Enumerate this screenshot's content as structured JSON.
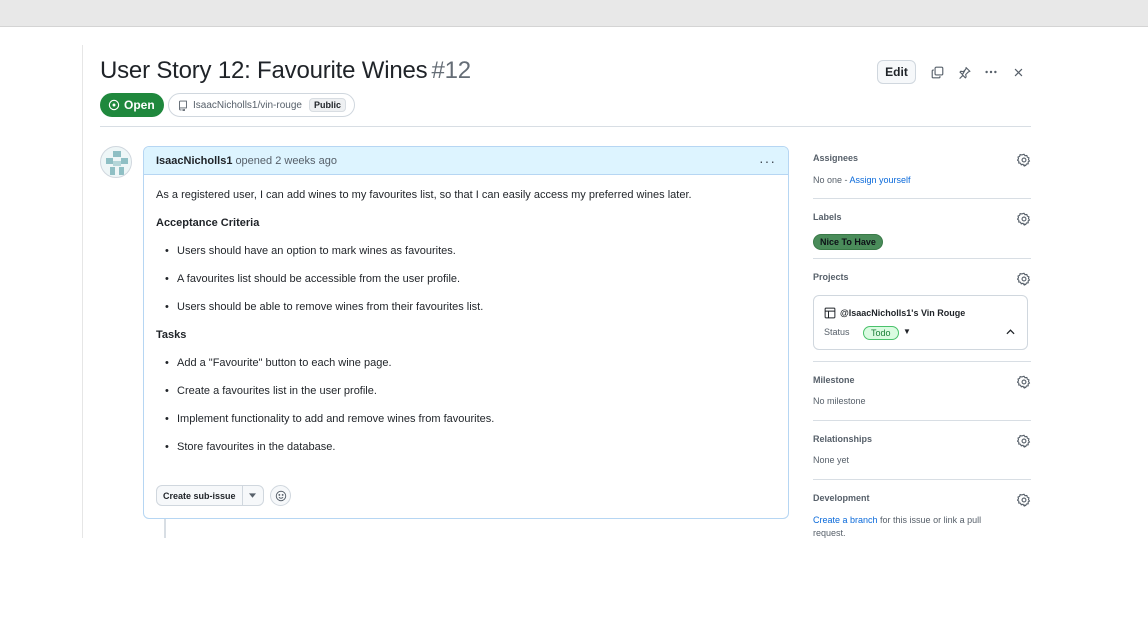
{
  "issue": {
    "title": "User Story 12: Favourite Wines",
    "number": "#12",
    "state": "Open",
    "repo": "IsaacNicholls1/vin-rouge",
    "visibility": "Public",
    "edit_label": "Edit"
  },
  "comment": {
    "author": "IsaacNicholls1",
    "meta": "opened 2 weeks ago",
    "intro": "As a registered user, I can add wines to my favourites list, so that I can easily access my preferred wines later.",
    "sections": [
      {
        "heading": "Acceptance Criteria",
        "items": [
          "Users should have an option to mark wines as favourites.",
          "A favourites list should be accessible from the user profile.",
          "Users should be able to remove wines from their favourites list."
        ]
      },
      {
        "heading": "Tasks",
        "items": [
          "Add a \"Favourite\" button to each wine page.",
          "Create a favourites list in the user profile.",
          "Implement functionality to add and remove wines from favourites.",
          "Store favourites in the database."
        ]
      }
    ],
    "sub_issue_label": "Create sub-issue"
  },
  "sidebar": {
    "assignees": {
      "title": "Assignees",
      "none": "No one - ",
      "link": "Assign yourself"
    },
    "labels": {
      "title": "Labels",
      "items": [
        "Nice To Have"
      ],
      "color": "#4a8c5a"
    },
    "projects": {
      "title": "Projects",
      "project_name": "@IsaacNicholls1's Vin Rouge",
      "status_label": "Status",
      "status_value": "Todo"
    },
    "milestone": {
      "title": "Milestone",
      "value": "No milestone"
    },
    "relationships": {
      "title": "Relationships",
      "value": "None yet"
    },
    "development": {
      "title": "Development",
      "link": "Create a branch",
      "text": " for this issue or link a pull request."
    }
  },
  "colors": {
    "open_green": "#1f883d",
    "link_blue": "#0969da",
    "comment_header": "#ddf4ff"
  }
}
